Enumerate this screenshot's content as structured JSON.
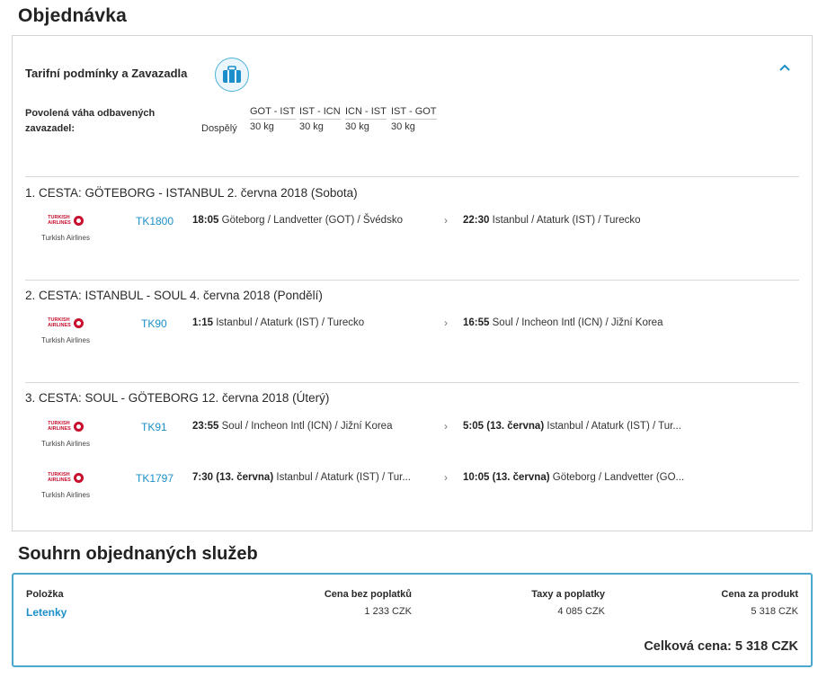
{
  "page_title": "Objednávka",
  "tariff": {
    "title": "Tarifní podmínky a Zavazadla",
    "icon": "luggage-icon",
    "collapse_icon": "chevron-up-icon",
    "baggage_label_line1": "Povolená váha odbavených",
    "baggage_label_line2": "zavazadel:",
    "passenger_type": "Dospělý",
    "routes": [
      {
        "route": "GOT - IST",
        "weight": "30 kg"
      },
      {
        "route": "IST - ICN",
        "weight": "30 kg"
      },
      {
        "route": "ICN - IST",
        "weight": "30 kg"
      },
      {
        "route": "IST - GOT",
        "weight": "30 kg"
      }
    ]
  },
  "airline": {
    "logo_line1": "TURKISH",
    "logo_line2": "AIRLINES",
    "name": "Turkish Airlines",
    "brand_color": "#c8102e"
  },
  "trips": [
    {
      "title": "1. CESTA: GÖTEBORG - ISTANBUL 2. června 2018 (Sobota)",
      "segments": [
        {
          "flight": "TK1800",
          "dep_time": "18:05",
          "dep_date": "",
          "dep_place": "Göteborg / Landvetter (GOT) / Švédsko",
          "arr_time": "22:30",
          "arr_date": "",
          "arr_place": "Istanbul / Ataturk (IST) / Turecko"
        }
      ]
    },
    {
      "title": "2. CESTA: ISTANBUL - SOUL 4. června 2018 (Pondělí)",
      "segments": [
        {
          "flight": "TK90",
          "dep_time": "1:15",
          "dep_date": "",
          "dep_place": "Istanbul / Ataturk (IST) / Turecko",
          "arr_time": "16:55",
          "arr_date": "",
          "arr_place": "Soul / Incheon Intl (ICN) / Jižní Korea"
        }
      ]
    },
    {
      "title": "3. CESTA: SOUL - GÖTEBORG 12. června 2018 (Úterý)",
      "segments": [
        {
          "flight": "TK91",
          "dep_time": "23:55",
          "dep_date": "",
          "dep_place": "Soul / Incheon Intl (ICN) / Jižní Korea",
          "arr_time": "5:05",
          "arr_date": "(13. června)",
          "arr_place": "Istanbul / Ataturk (IST) / Tur..."
        },
        {
          "flight": "TK1797",
          "dep_time": "7:30",
          "dep_date": "(13. června)",
          "dep_place": "Istanbul / Ataturk (IST) / Tur...",
          "arr_time": "10:05",
          "arr_date": "(13. června)",
          "arr_place": "Göteborg / Landvetter (GO..."
        }
      ]
    }
  ],
  "summary": {
    "title": "Souhrn objednaných služeb",
    "col_item": "Položka",
    "col_price": "Cena bez poplatků",
    "col_taxes": "Taxy a poplatky",
    "col_total": "Cena za produkt",
    "item": "Letenky",
    "price": "1 233 CZK",
    "taxes": "4 085 CZK",
    "product_total": "5 318 CZK",
    "grand_total": "Celková cena: 5 318 CZK",
    "accent_color": "#4aa8cf"
  }
}
